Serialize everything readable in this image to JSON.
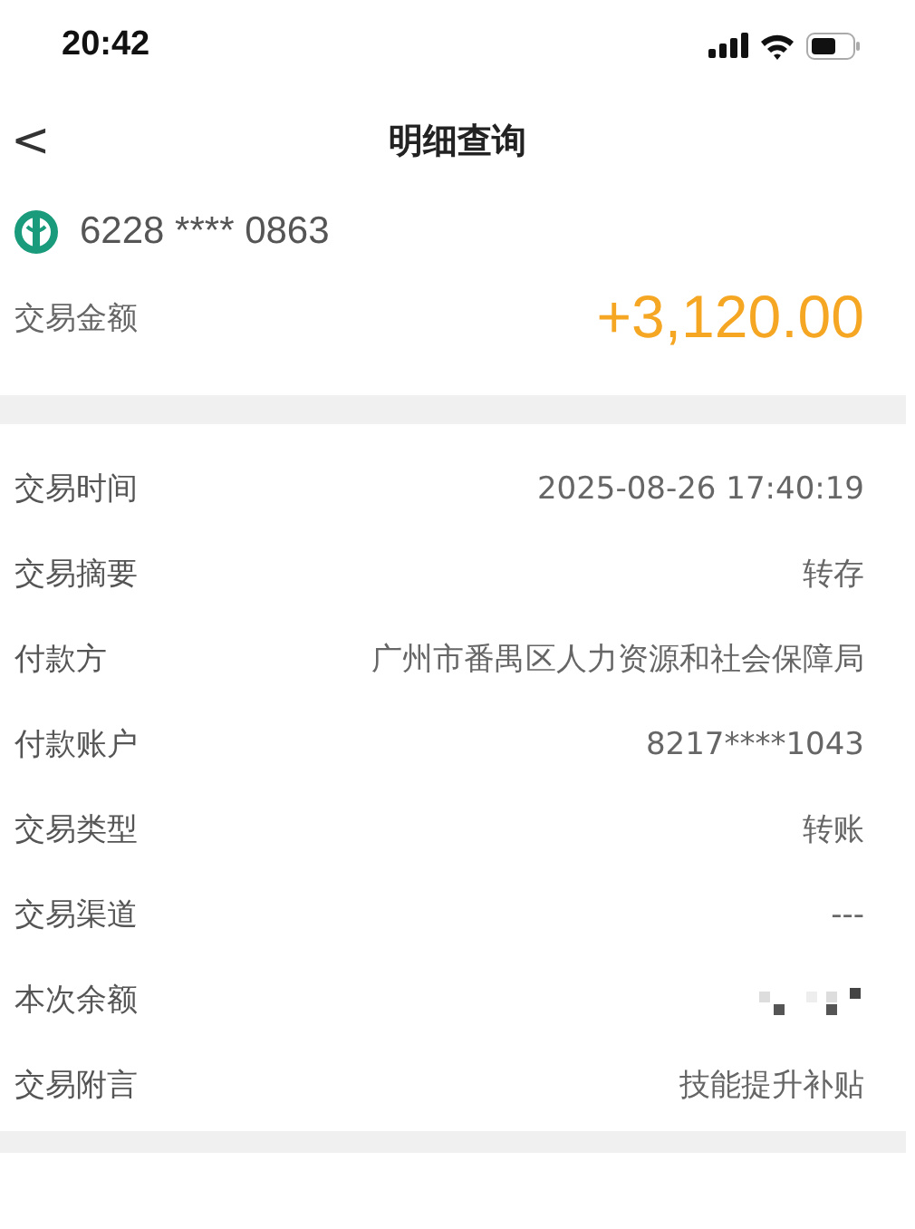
{
  "status_bar": {
    "time": "20:42"
  },
  "nav": {
    "back": "<",
    "title": "明细查询"
  },
  "account": {
    "number": "6228 **** 0863"
  },
  "amount": {
    "label": "交易金额",
    "value": "+3,120.00"
  },
  "details": [
    {
      "kind": "text",
      "label": "交易时间",
      "value": "2025-08-26 17:40:19"
    },
    {
      "kind": "text",
      "label": "交易摘要",
      "value": "转存"
    },
    {
      "kind": "text",
      "label": "付款方",
      "value": "广州市番禺区人力资源和社会保障局"
    },
    {
      "kind": "text",
      "label": "付款账户",
      "value": "8217****1043"
    },
    {
      "kind": "text",
      "label": "交易类型",
      "value": "转账"
    },
    {
      "kind": "text",
      "label": "交易渠道",
      "value": "---"
    },
    {
      "kind": "masked",
      "label": "本次余额"
    },
    {
      "kind": "text",
      "label": "交易附言",
      "value": "技能提升补贴"
    }
  ]
}
